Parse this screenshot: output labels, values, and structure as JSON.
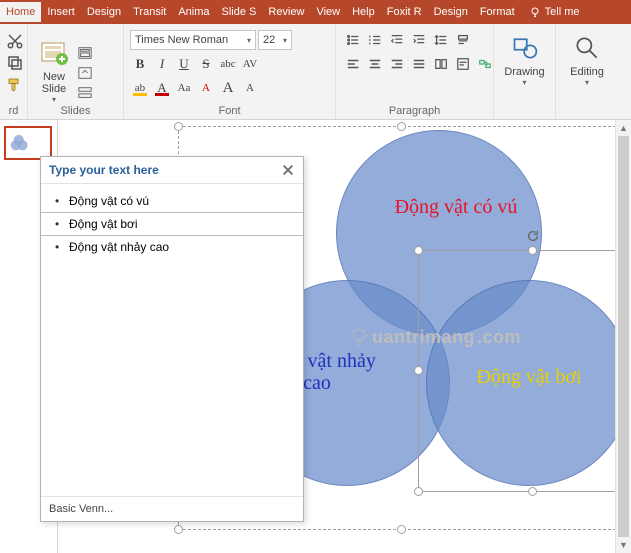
{
  "tabs": {
    "items": [
      "Home",
      "Insert",
      "Design",
      "Transit",
      "Anima",
      "Slide S",
      "Review",
      "View",
      "Help",
      "Foxit R",
      "Design",
      "Format"
    ],
    "active_index": 0,
    "tellme": "Tell me"
  },
  "ribbon": {
    "clipboard": {
      "label": "rd"
    },
    "slides": {
      "label": "Slides",
      "new_slide": "New\nSlide"
    },
    "font": {
      "label": "Font",
      "family": "Times New Roman",
      "size": "22",
      "buttons": {
        "bold": "B",
        "italic": "I",
        "underline": "U",
        "strike": "S",
        "shadow": "abc",
        "spacing": "AV",
        "highlight": "ab",
        "fontcolor": "A",
        "caseAa": "Aa",
        "clear": "A",
        "grow": "A",
        "shrink": "A"
      }
    },
    "paragraph": {
      "label": "Paragraph"
    },
    "drawing": {
      "label": "Drawing"
    },
    "editing": {
      "label": "Editing"
    }
  },
  "text_pane": {
    "title": "Type your text here",
    "items": [
      "Động vật có vú",
      "Động vật bơi",
      "Động vật nhảy cao"
    ],
    "selected_index": 1,
    "footer": "Basic Venn..."
  },
  "venn": {
    "labels": [
      "Động vật có vú",
      "Động vật nhảy cao",
      "Động vật bơi"
    ]
  },
  "watermark": "uantrimang"
}
